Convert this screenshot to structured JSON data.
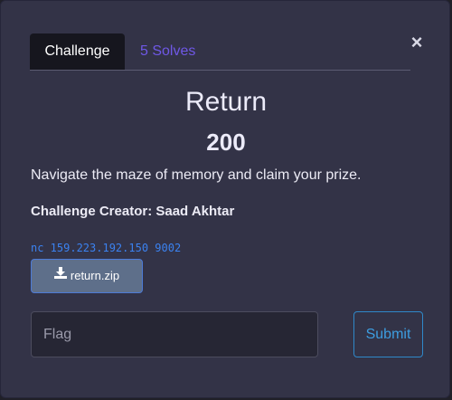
{
  "modal": {
    "close_label": "×"
  },
  "tabs": [
    {
      "label": "Challenge",
      "active": true
    },
    {
      "label": "5 Solves",
      "active": false
    }
  ],
  "challenge": {
    "name": "Return",
    "points": "200",
    "description": "Navigate the maze of memory and claim your prize.",
    "creator": "Challenge Creator: Saad Akhtar",
    "connection": "nc 159.223.192.150 9002",
    "file": {
      "label": "return.zip",
      "icon": "download-icon"
    }
  },
  "form": {
    "flag_placeholder": "Flag",
    "flag_value": "",
    "submit_label": "Submit"
  },
  "colors": {
    "background": "#333347",
    "tab_active": "#16161e",
    "solves_link": "#6f58e6",
    "connection_text": "#3b82f0",
    "download_button": "#5e6f8a",
    "submit_border": "#2f88c9"
  }
}
